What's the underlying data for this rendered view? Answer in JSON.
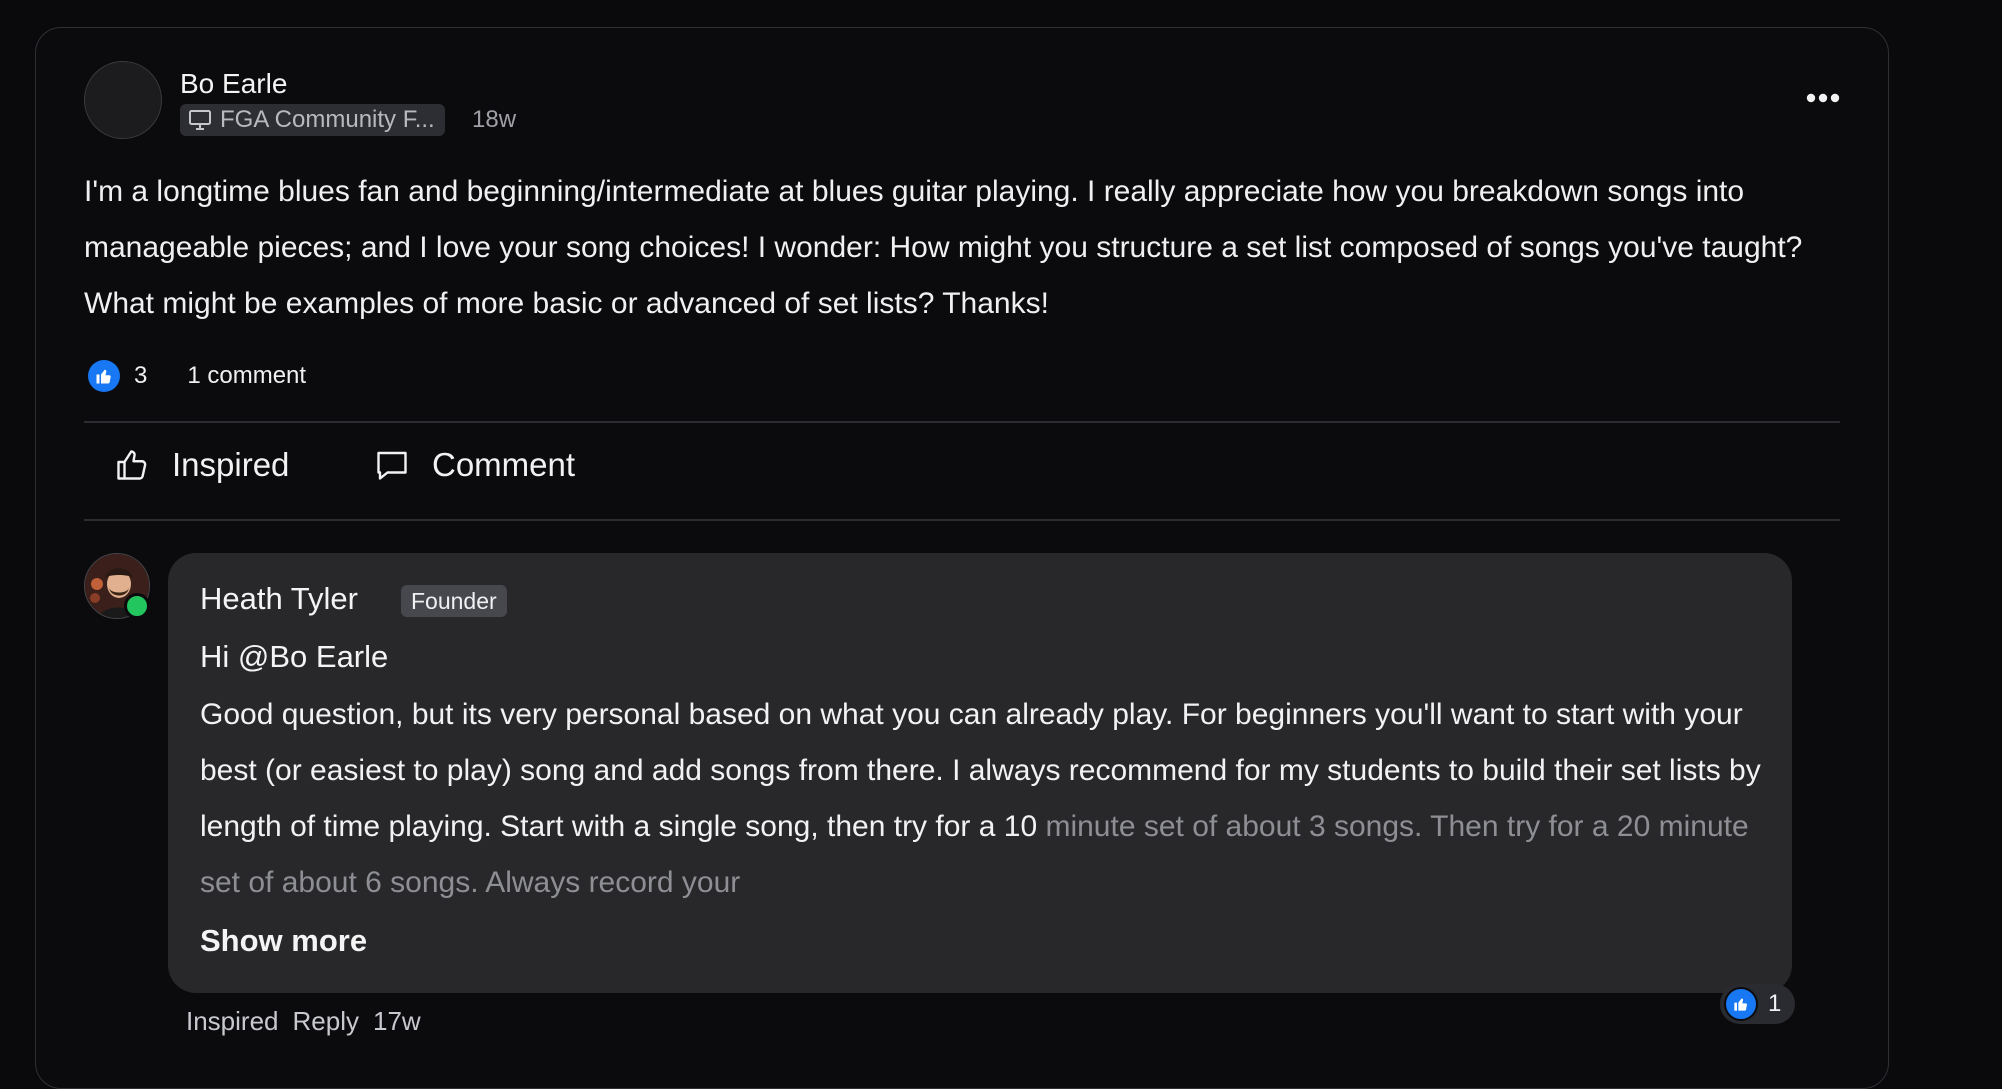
{
  "post": {
    "author": "Bo Earle",
    "group": "FGA Community F...",
    "time": "18w",
    "body": "I'm a longtime blues fan and beginning/intermediate at blues guitar playing. I really appreciate how you breakdown songs into manageable pieces; and I love your song choices! I wonder: How might you structure a set list composed of songs you've taught? What might be examples of more basic or advanced of set lists? Thanks!",
    "like_count": "3",
    "comment_count": "1 comment"
  },
  "actions": {
    "inspired": "Inspired",
    "comment": "Comment"
  },
  "comment": {
    "author": "Heath Tyler",
    "badge": "Founder",
    "greeting": "Hi @Bo Earle",
    "body_visible": "Good question, but its very personal based on what you can already play. For beginners you'll want to start with your best (or easiest to play) song and add songs from there. I always recommend for my students to build their set lists by length of time playing. Start with a single song, then try for a 10",
    "body_faded": "minute set of about 3 songs. Then try for a 20 minute set of about 6 songs. Always record your",
    "show_more": "Show more",
    "like_count": "1",
    "inspired": "Inspired",
    "reply": "Reply",
    "time": "17w"
  },
  "colors": {
    "background": "#0a0a0c",
    "bubble": "#28282b",
    "like_blue": "#1877f2",
    "online_green": "#22c55e"
  },
  "icons": [
    "monitor-icon",
    "more-horizontal-icon",
    "thumbs-up-icon",
    "comment-bubble-icon"
  ]
}
